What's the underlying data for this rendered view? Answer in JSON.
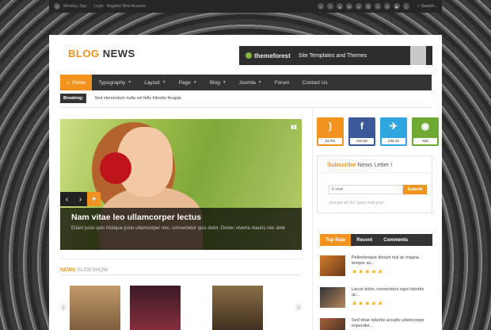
{
  "topbar": {
    "date": "Monday, Sep",
    "login": "Login",
    "register": "Register New Account",
    "search_placeholder": "Search...",
    "social_icons": [
      "twitter-icon",
      "facebook-icon",
      "google-plus-icon",
      "linkedin-icon",
      "pinterest-icon",
      "dribbble-icon",
      "vimeo-icon",
      "flickr-icon",
      "youtube-icon",
      "rss-icon"
    ]
  },
  "logo": {
    "part1": "BLOG",
    "part2": "NEWS"
  },
  "banner": {
    "brand": "themeforest",
    "tagline": "Site Templates and Themes"
  },
  "nav": {
    "items": [
      {
        "label": "Home",
        "active": true
      },
      {
        "label": "Typography",
        "caret": true
      },
      {
        "label": "Layout",
        "caret": true
      },
      {
        "label": "Page",
        "caret": true
      },
      {
        "label": "Blog",
        "caret": true
      },
      {
        "label": "Joomla",
        "caret": true
      },
      {
        "label": "Forum"
      },
      {
        "label": "Contact Us"
      }
    ]
  },
  "breaking": {
    "label": "Breaking:",
    "text": "Sed elementum nulla vel felis lobortis feugiat."
  },
  "slider": {
    "title": "Nam vitae leo ullamcorper lectus",
    "text": "Etiam justo quis tristique justo ullamcorper nec, consectetur quis dolor. Donec viverra mauris nec ante"
  },
  "news_slideshow": {
    "title_accent": "NEWS",
    "title_rest": "SLIDESHOW"
  },
  "social_counters": [
    {
      "name": "rss",
      "count": "22.RS"
    },
    {
      "name": "facebook",
      "count": "523.00"
    },
    {
      "name": "twitter",
      "count": "236.18"
    },
    {
      "name": "group",
      "count": "928"
    }
  ],
  "subscribe": {
    "title_accent": "Subscribe",
    "title_rest": "News Letter !",
    "placeholder": "E-mail",
    "button": "Submit",
    "note": "Just get all Not Spam mail ever."
  },
  "tabs": [
    "Top Rate",
    "Recent",
    "Comments"
  ],
  "posts": [
    {
      "title": "Pellentesque dictum nisl ac magna tempor ac...",
      "stars": "★★★★★"
    },
    {
      "title": "Lacus dolor, consectetur eget lobortis ac...",
      "stars": "★★★★★"
    },
    {
      "title": "Sed vitae lobortis arcudio ullamcorper imperdiet...",
      "stars": ""
    }
  ]
}
